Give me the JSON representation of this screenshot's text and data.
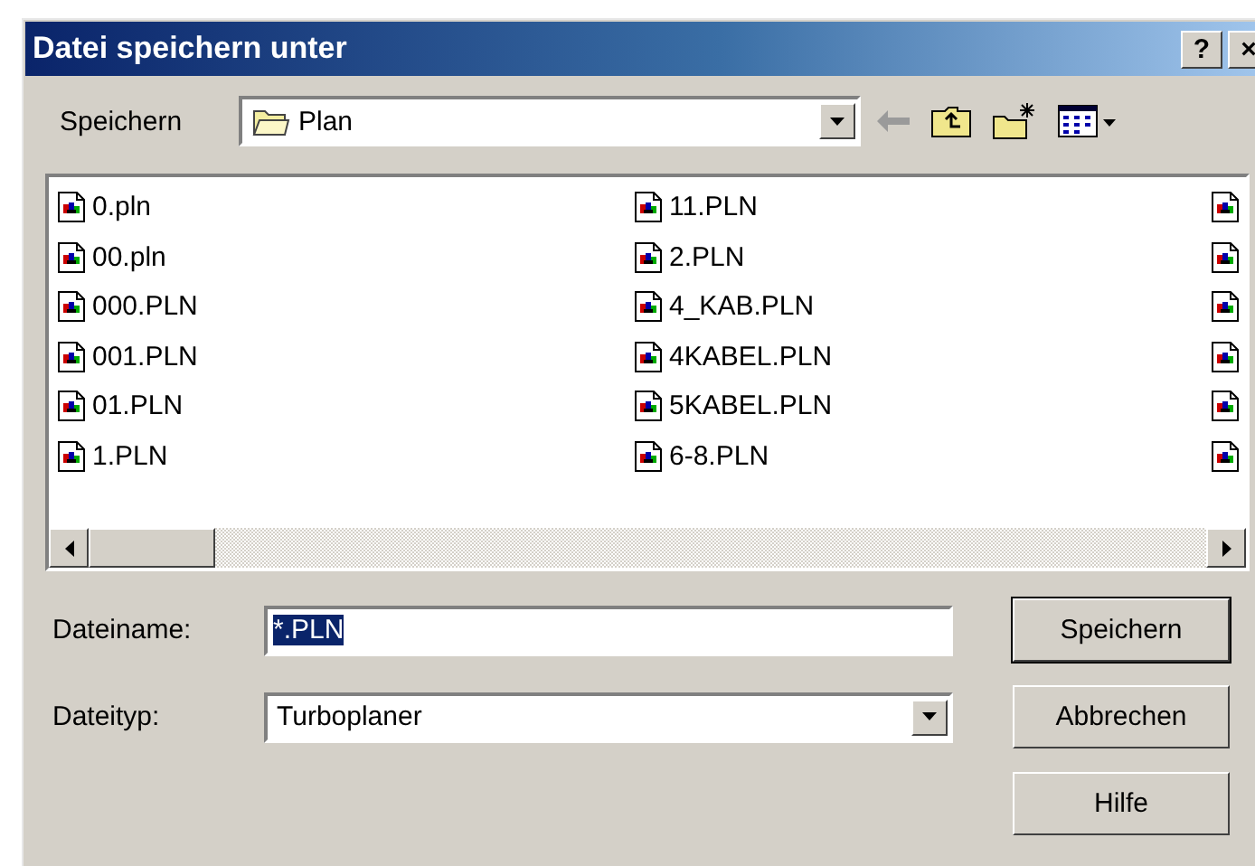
{
  "window": {
    "title": "Datei speichern unter",
    "title_buttons": [
      "?",
      "×"
    ]
  },
  "location": {
    "label": "Speichern",
    "folder": "Plan"
  },
  "files": {
    "columns": [
      [
        "0.pln",
        "00.pln",
        "000.PLN",
        "001.PLN",
        "01.PLN",
        "1.PLN"
      ],
      [
        "11.PLN",
        "2.PLN",
        "4_KAB.PLN",
        "4KABEL.PLN",
        "5KABEL.PLN",
        "6-8.PLN"
      ]
    ]
  },
  "filename": {
    "label": "Dateiname:",
    "value": "*.PLN",
    "selected": true
  },
  "filetype": {
    "label": "Dateityp:",
    "value": "Turboplaner"
  },
  "buttons": [
    {
      "label": "Speichern",
      "default": true
    },
    {
      "label": "Abbrechen",
      "default": false
    },
    {
      "label": "Hilfe",
      "default": false
    }
  ]
}
